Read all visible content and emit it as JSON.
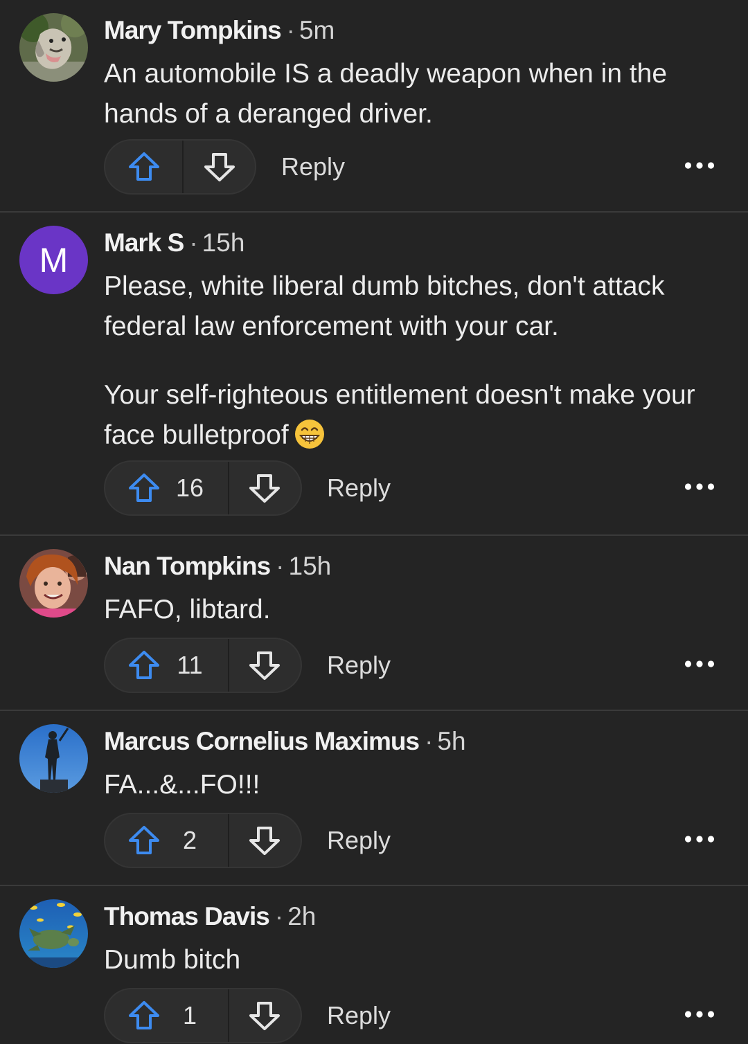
{
  "comments": [
    {
      "name": "Mary Tompkins",
      "time": "5m",
      "avatar_icon": "dog-photo-avatar",
      "paragraphs": [
        "An automobile IS a deadly weapon when in the hands of a deranged driver."
      ],
      "upvotes": "",
      "reply_label": "Reply"
    },
    {
      "name": "Mark S",
      "time": "15h",
      "avatar_icon": "letter-avatar",
      "avatar_letter": "M",
      "avatar_color": "#6a35c6",
      "paragraphs": [
        "Please, white liberal dumb bitches, don't attack federal law enforcement with your car.",
        "Your self-righteous entitlement doesn't make your face bulletproof"
      ],
      "trailing_emoji": "grinning-face-emoji",
      "upvotes": "16",
      "reply_label": "Reply"
    },
    {
      "name": "Nan Tompkins",
      "time": "15h",
      "avatar_icon": "woman-photo-avatar",
      "paragraphs": [
        "FAFO, libtard."
      ],
      "upvotes": "11",
      "reply_label": "Reply"
    },
    {
      "name": "Marcus Cornelius Maximus",
      "time": "5h",
      "avatar_icon": "statue-photo-avatar",
      "paragraphs": [
        "FA...&...FO!!!"
      ],
      "upvotes": "2",
      "reply_label": "Reply"
    },
    {
      "name": "Thomas Davis",
      "time": "2h",
      "avatar_icon": "sea-turtle-photo-avatar",
      "paragraphs": [
        "Dumb bitch"
      ],
      "upvotes": "1",
      "reply_label": "Reply"
    }
  ],
  "colors": {
    "background": "#242424",
    "upvote_accent": "#3d8bf0",
    "divider": "#3a3a3a"
  },
  "icons": {
    "upvote": "arrow-up-outline-icon",
    "downvote": "arrow-down-outline-icon",
    "more": "ellipsis-horizontal-icon"
  }
}
